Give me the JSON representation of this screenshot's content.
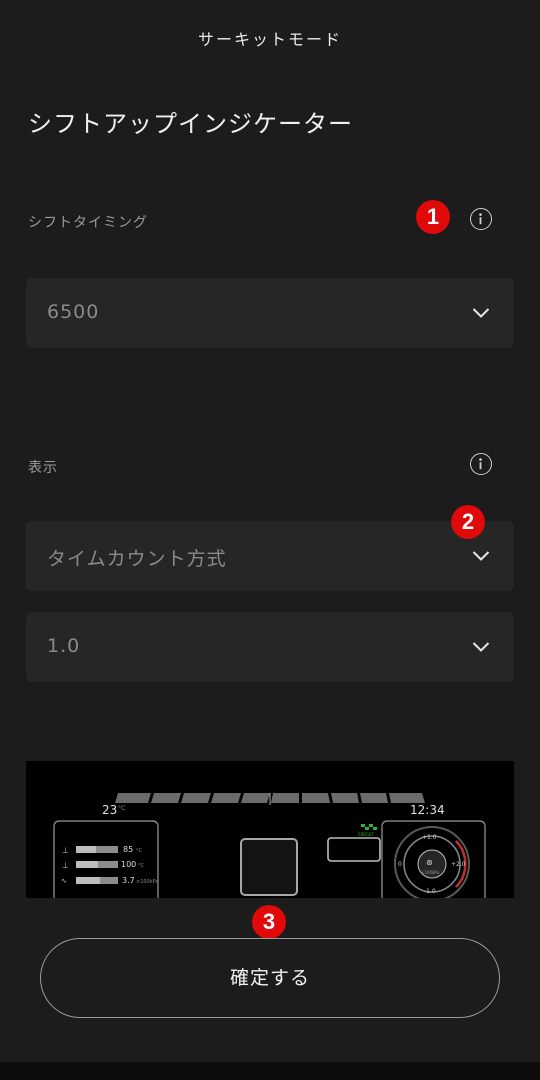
{
  "header": {
    "title": "サーキットモード"
  },
  "page": {
    "title": "シフトアップインジケーター"
  },
  "shift_timing": {
    "label": "シフトタイミング",
    "value": "6500"
  },
  "display": {
    "label": "表示",
    "mode_value": "タイムカウント方式",
    "time_value": "1.0"
  },
  "badges": [
    "1",
    "2",
    "3"
  ],
  "preview": {
    "temp": "23",
    "temp_unit": "°C",
    "clock": "12:34",
    "gauges": [
      {
        "value": "85",
        "unit": "°C"
      },
      {
        "value": "100",
        "unit": "°C"
      },
      {
        "value": "3.7",
        "unit": "×100kPa"
      }
    ],
    "boost_top": "+1.0",
    "boost_left": "0",
    "boost_right": "+2.0",
    "boost_bottom": "-1.0",
    "boost_unit": "×100kPa",
    "circuit_label": "CIRCUIT"
  },
  "confirm_button": {
    "label": "確定する"
  },
  "colors": {
    "background": "#1c1c1c",
    "select_bg": "#262626",
    "badge": "#e00a0a"
  },
  "icons": [
    "info-icon",
    "chevron-down-icon"
  ]
}
